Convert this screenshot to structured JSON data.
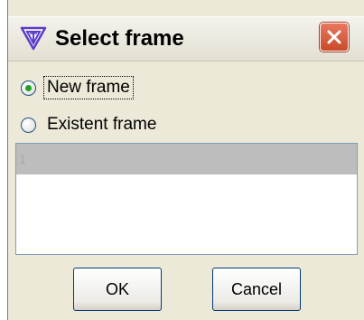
{
  "window": {
    "title": "Select frame",
    "app_icon": "tool-logo-icon",
    "close_icon": "close-icon"
  },
  "options": {
    "new_frame_label": "New frame",
    "new_frame_checked": true,
    "existent_frame_label": "Existent frame",
    "existent_frame_checked": false
  },
  "frame_list": {
    "items": [
      "1"
    ],
    "selected_index": 0
  },
  "buttons": {
    "ok_label": "OK",
    "cancel_label": "Cancel"
  },
  "colors": {
    "dialog_bg": "#ece9d8",
    "close_button": "#d85b3a",
    "icon_accent": "#5a3cc8",
    "selected_row": "#bdbdbd"
  }
}
